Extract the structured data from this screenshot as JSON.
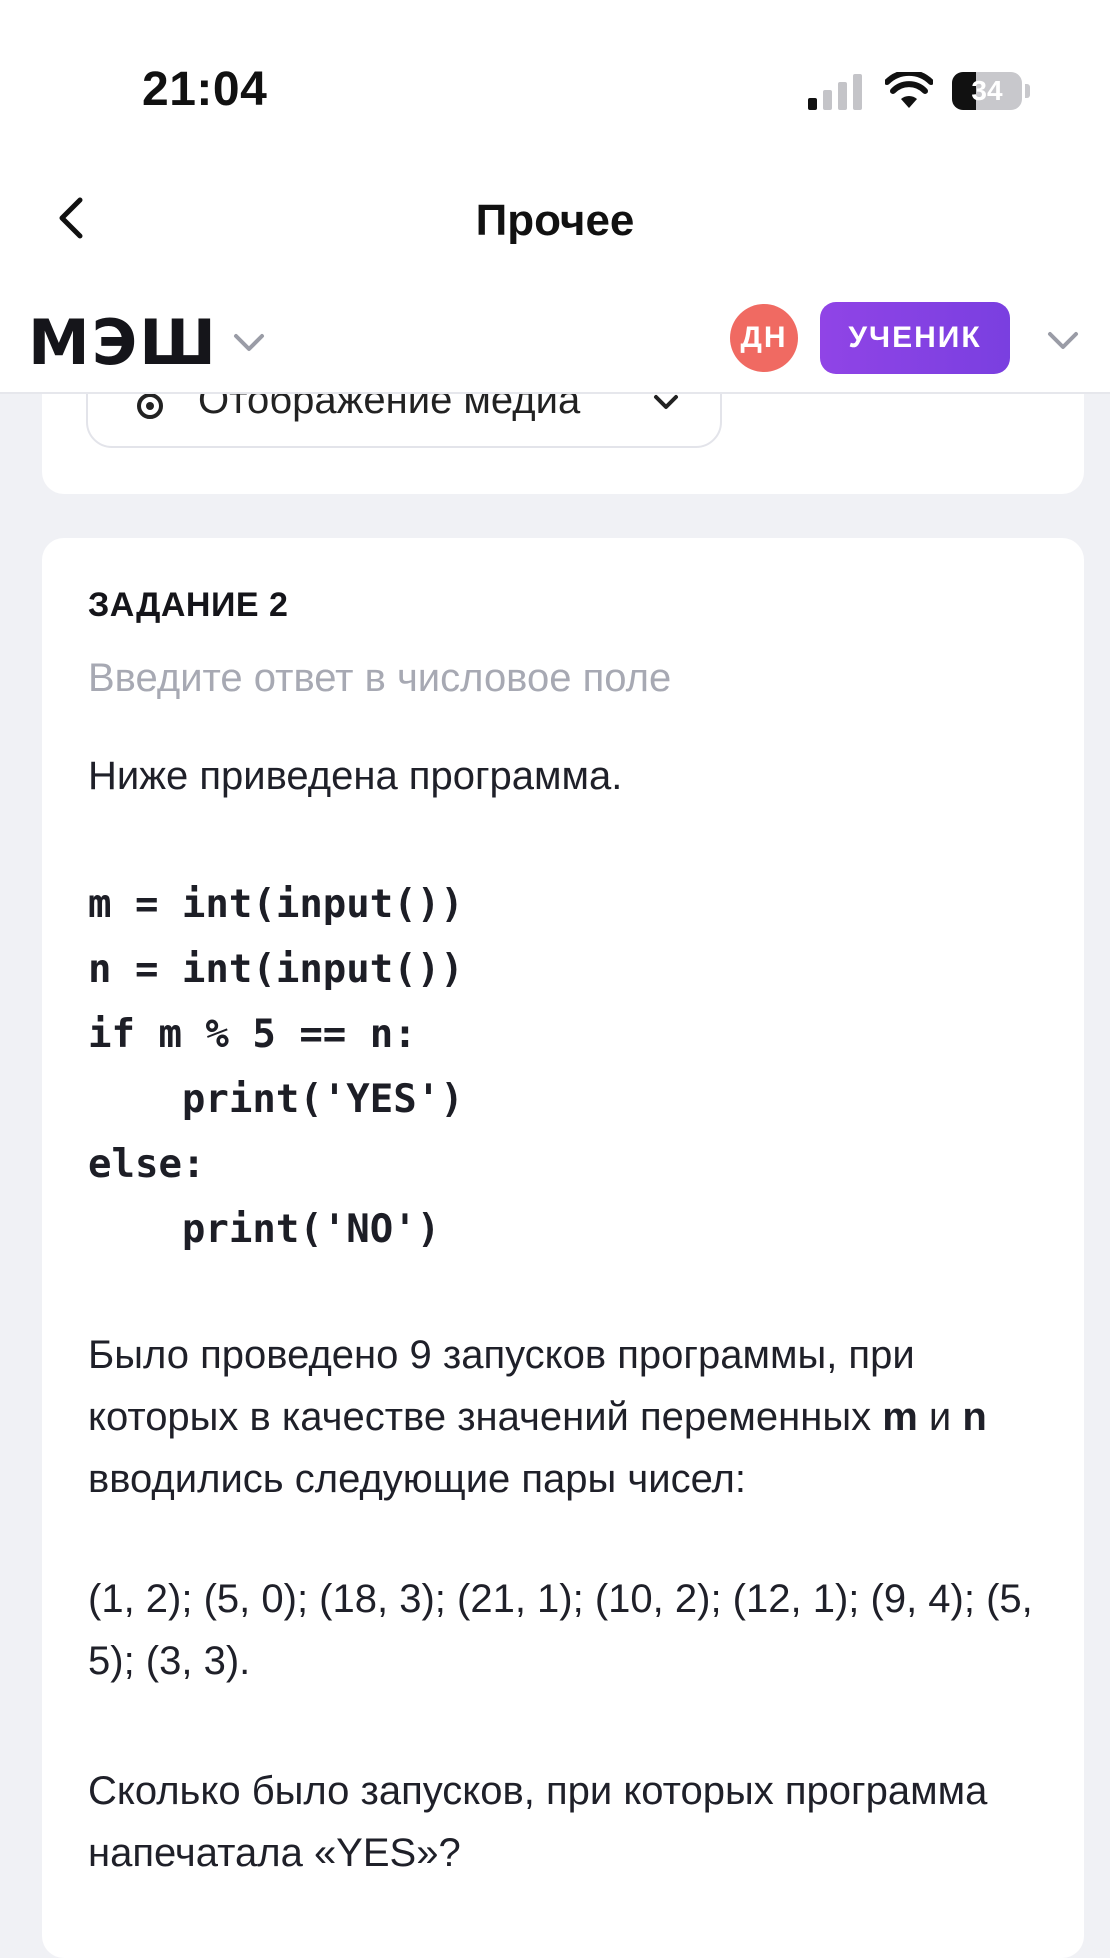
{
  "status_bar": {
    "time": "21:04",
    "battery_level": "34",
    "battery_fraction": 0.34,
    "icons": [
      "signal-icon",
      "wifi-icon",
      "battery-icon"
    ]
  },
  "nav": {
    "title": "Прочее",
    "back_icon": "chevron-left-icon"
  },
  "header": {
    "logo": "МЭШ",
    "avatar_initials": "ДН",
    "role_button": "УЧЕНИК",
    "colors": {
      "avatar": "#f06a62",
      "role_button": "#8a44e5"
    }
  },
  "media": {
    "label": "Отображение медиа",
    "icon": "gear-icon"
  },
  "task": {
    "number": "ЗАДАНИЕ 2",
    "hint": "Введите ответ в числовое поле",
    "intro": "Ниже приведена программа.",
    "code": "m = int(input())\nn = int(input())\nif m % 5 == n:\n    print('YES')\nelse:\n    print('NO')",
    "paragraph1_part1": "Было проведено 9 запусков программы, при которых в качестве значений переменных ",
    "var_m": "m",
    "and_word": " и ",
    "var_n": "n",
    "paragraph1_part2": " вводились следующие пары чисел:",
    "pairs": "(1, 2); (5, 0); (18, 3); (21, 1); (10, 2); (12, 1); (9, 4); (5, 5); (3, 3).",
    "question": "Сколько было запусков, при которых программа напечатала «YES»?"
  }
}
